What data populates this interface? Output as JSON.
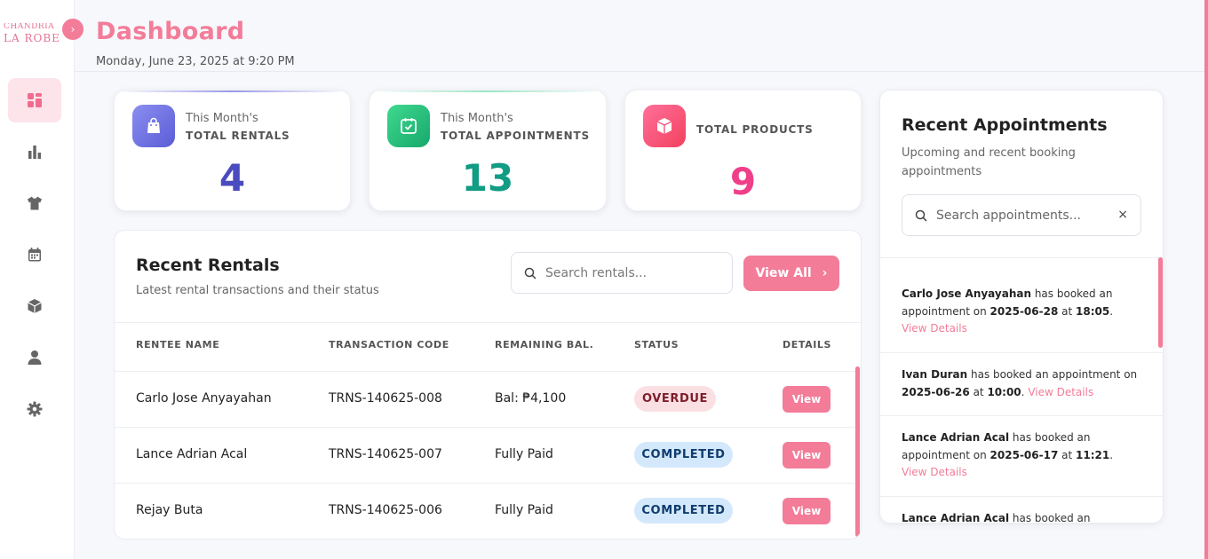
{
  "sidebar": {
    "logo_line1": "CHANDRIA",
    "logo_line2": "LA ROBE",
    "toggle_icon": "chevron-right-icon",
    "items": [
      {
        "icon": "dashboard-icon",
        "active": true
      },
      {
        "icon": "bar-chart-icon",
        "active": false
      },
      {
        "icon": "tshirt-icon",
        "active": false
      },
      {
        "icon": "calendar-icon",
        "active": false
      },
      {
        "icon": "box-icon",
        "active": false
      },
      {
        "icon": "user-icon",
        "active": false
      },
      {
        "icon": "gear-icon",
        "active": false
      }
    ]
  },
  "header": {
    "title": "Dashboard",
    "date": "Monday, June 23, 2025 at 9:20 PM"
  },
  "stats": [
    {
      "sub": "This Month's",
      "label": "TOTAL RENTALS",
      "value": "4",
      "icon": "shopping-bag-icon",
      "color": "#4a4bbf"
    },
    {
      "sub": "This Month's",
      "label": "TOTAL APPOINTMENTS",
      "value": "13",
      "icon": "calendar-check-icon",
      "color": "#119c84"
    },
    {
      "sub": "",
      "label": "TOTAL PRODUCTS",
      "value": "9",
      "icon": "cube-icon",
      "color": "#ef3f8b"
    }
  ],
  "rentals": {
    "title": "Recent Rentals",
    "subtitle": "Latest rental transactions and their status",
    "search_placeholder": "Search rentals...",
    "view_all": "View All",
    "columns": [
      "RENTEE NAME",
      "TRANSACTION CODE",
      "REMAINING BAL.",
      "STATUS",
      "DETAILS"
    ],
    "rows": [
      {
        "name": "Carlo Jose Anyayahan",
        "code": "TRNS-140625-008",
        "balance": "Bal: ₱4,100",
        "status": "OVERDUE",
        "action": "View"
      },
      {
        "name": "Lance Adrian Acal",
        "code": "TRNS-140625-007",
        "balance": "Fully Paid",
        "status": "COMPLETED",
        "action": "View"
      },
      {
        "name": "Rejay Buta",
        "code": "TRNS-140625-006",
        "balance": "Fully Paid",
        "status": "COMPLETED",
        "action": "View"
      }
    ]
  },
  "appointments": {
    "title": "Recent Appointments",
    "subtitle": "Upcoming and recent booking appointments",
    "search_placeholder": "Search appointments...",
    "clear": "×",
    "items": [
      {
        "name": "Carlo Jose Anyayahan",
        "text1": " has booked an appointment on ",
        "date": "2025-06-28",
        "text2": " at ",
        "time": "18:05",
        "end": ".",
        "link": "View Details"
      },
      {
        "name": "Ivan Duran",
        "text1": " has booked an appointment on ",
        "date": "2025-06-26",
        "text2": " at ",
        "time": "10:00",
        "end": ".",
        "link": "View Details"
      },
      {
        "name": "Lance Adrian Acal",
        "text1": " has booked an appointment on ",
        "date": "2025-06-17",
        "text2": " at ",
        "time": "11:21",
        "end": ".",
        "link": "View Details"
      },
      {
        "name": "Lance Adrian Acal",
        "text1": " has booked an",
        "date": "",
        "text2": "",
        "time": "",
        "end": "",
        "link": ""
      }
    ]
  }
}
